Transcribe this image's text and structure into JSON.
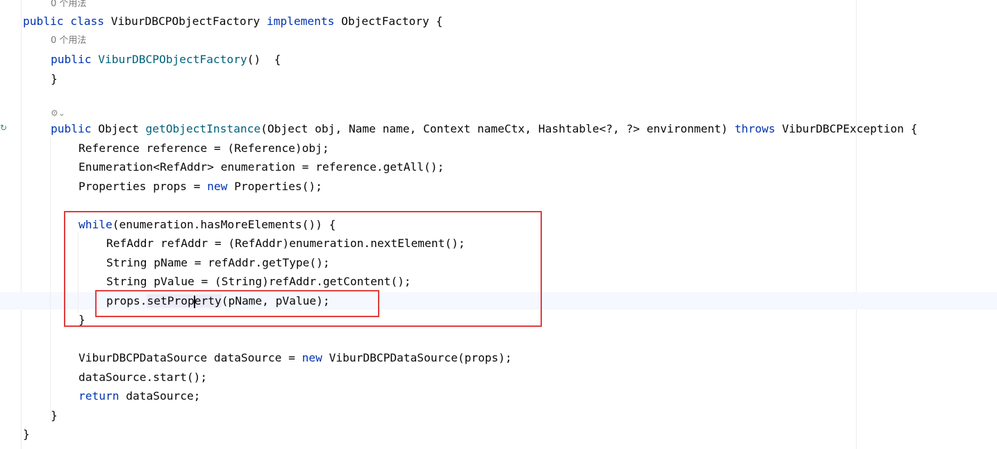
{
  "hints": {
    "class_usage": "0 个用法",
    "ctor_usage": "0 个用法"
  },
  "tokens": {
    "public": "public",
    "class": "class",
    "implements": "implements",
    "new": "new",
    "while": "while",
    "throws": "throws",
    "return": "return"
  },
  "names": {
    "class_name": "ViburDBCPObjectFactory",
    "ctor_name": "ViburDBCPObjectFactory",
    "method_name": "getObjectInstance",
    "call_prefix": "setProp",
    "call_suffix": "erty"
  },
  "code": {
    "l1_post": " ObjectFactory {",
    "l2": "()  {",
    "l3": "}",
    "l4_mid": " Object ",
    "l4_post": "(Object obj, Name name, Context nameCtx, Hashtable<?, ?> environment) ",
    "l4_end": " ViburDBCPException {",
    "l5": "Reference reference = (Reference)obj;",
    "l6": "Enumeration<RefAddr> enumeration = reference.getAll();",
    "l7_pre": "Properties props = ",
    "l7_post": " Properties();",
    "l8_post": "(enumeration.hasMoreElements()) {",
    "l9": "RefAddr refAddr = (RefAddr)enumeration.nextElement();",
    "l10": "String pName = refAddr.getType();",
    "l11": "String pValue = (String)refAddr.getContent();",
    "l12_pre": "props.",
    "l12_post": "(pName, pValue);",
    "l13": "}",
    "l14_pre": "ViburDBCPDataSource dataSource = ",
    "l14_post": " ViburDBCPDataSource(props);",
    "l15": "dataSource.start();",
    "l16_post": " dataSource;",
    "l17": "}",
    "l18": "}"
  },
  "icons": {
    "gutter": "override-gutter-icon",
    "inlay": "generate-icon"
  },
  "colors": {
    "keyword": "#0033b3",
    "function": "#00627a",
    "text": "#080808",
    "hint": "#767676",
    "highlight_box": "#e03c3c"
  }
}
